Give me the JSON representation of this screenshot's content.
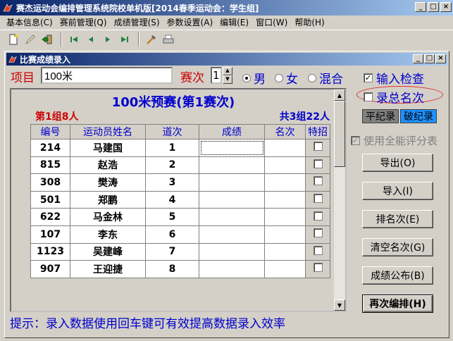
{
  "window": {
    "title": "赛杰运动会编排管理系统院校单机版[2014春季运动会：学生组]",
    "min_label": "_",
    "max_label": "□",
    "close_label": "×"
  },
  "menu": [
    {
      "label": "基本信息(C)"
    },
    {
      "label": "赛前管理(Q)"
    },
    {
      "label": "成绩管理(S)"
    },
    {
      "label": "参数设置(A)"
    },
    {
      "label": "编辑(E)"
    },
    {
      "label": "窗口(W)"
    },
    {
      "label": "帮助(H)"
    }
  ],
  "toolbar": {
    "icons": [
      "new-icon",
      "edit-icon",
      "exit-icon",
      "first-icon",
      "prev-icon",
      "next-icon",
      "last-icon",
      "tools-icon",
      "print-icon"
    ]
  },
  "child_window": {
    "title": "比赛成绩录入"
  },
  "form": {
    "event_label": "项目",
    "event_value": "100米",
    "round_label": "赛次",
    "round_value": "1",
    "gender_options": [
      "男",
      "女",
      "混合"
    ],
    "gender_selected": "男",
    "input_check_label": "输入检查",
    "input_check_checked": true,
    "record_rank_label": "录总名次",
    "record_rank_checked": false,
    "tie_record_label": "平纪录",
    "break_record_label": "破纪录",
    "all_round_label": "使用全能评分表"
  },
  "grid": {
    "title": "100米预赛(第1赛次)",
    "group_info": "第1组8人",
    "total_info": "共3组22人",
    "columns": [
      "编号",
      "运动员姓名",
      "道次",
      "成绩",
      "名次",
      "特招"
    ],
    "rows": [
      {
        "id": "214",
        "name": "马建国",
        "lane": "1",
        "score": "",
        "rank": ""
      },
      {
        "id": "815",
        "name": "赵浩",
        "lane": "2",
        "score": "",
        "rank": ""
      },
      {
        "id": "308",
        "name": "樊涛",
        "lane": "3",
        "score": "",
        "rank": ""
      },
      {
        "id": "501",
        "name": "郑鹏",
        "lane": "4",
        "score": "",
        "rank": ""
      },
      {
        "id": "622",
        "name": "马金林",
        "lane": "5",
        "score": "",
        "rank": ""
      },
      {
        "id": "107",
        "name": "李东",
        "lane": "6",
        "score": "",
        "rank": ""
      },
      {
        "id": "1123",
        "name": "吴建峰",
        "lane": "7",
        "score": "",
        "rank": ""
      },
      {
        "id": "907",
        "name": "王迎捷",
        "lane": "8",
        "score": "",
        "rank": ""
      }
    ]
  },
  "buttons": {
    "export": "导出(O)",
    "import": "导入(I)",
    "rank": "排名次(E)",
    "clear_rank": "清空名次(G)",
    "publish": "成绩公布(B)",
    "rearrange": "再次编排(H)"
  },
  "hint": "提示：录入数据使用回车键可有效提高数据录入效率",
  "colors": {
    "title_bar": "#0a246a",
    "label_red": "#cc0000",
    "label_blue": "#0000cc",
    "tie_record_bg": "#808080",
    "break_record_bg": "#1e90ff"
  }
}
